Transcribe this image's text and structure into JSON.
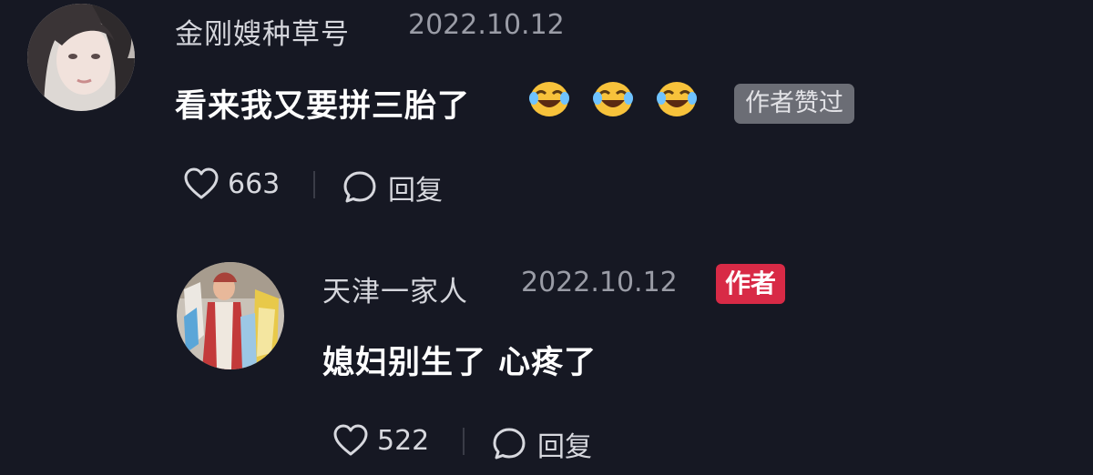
{
  "colors": {
    "background": "#161823",
    "author_badge": "#d82a46",
    "liked_badge": "#6b6d75"
  },
  "comments": [
    {
      "username": "金刚嫂种草号",
      "date": "2022.10.12",
      "text": "看来我又要拼三胎了",
      "emojis": [
        "laughing-tears-emoji",
        "laughing-tears-emoji",
        "laughing-tears-emoji"
      ],
      "badge": "作者赞过",
      "like_count": "663",
      "reply_label": "回复",
      "icons": {
        "like": "heart-icon",
        "reply": "comment-bubble-icon"
      }
    },
    {
      "username": "天津一家人",
      "date": "2022.10.12",
      "badge": "作者",
      "text": "媳妇别生了 心疼了",
      "like_count": "522",
      "reply_label": "回复",
      "icons": {
        "like": "heart-icon",
        "reply": "comment-bubble-icon"
      }
    }
  ]
}
